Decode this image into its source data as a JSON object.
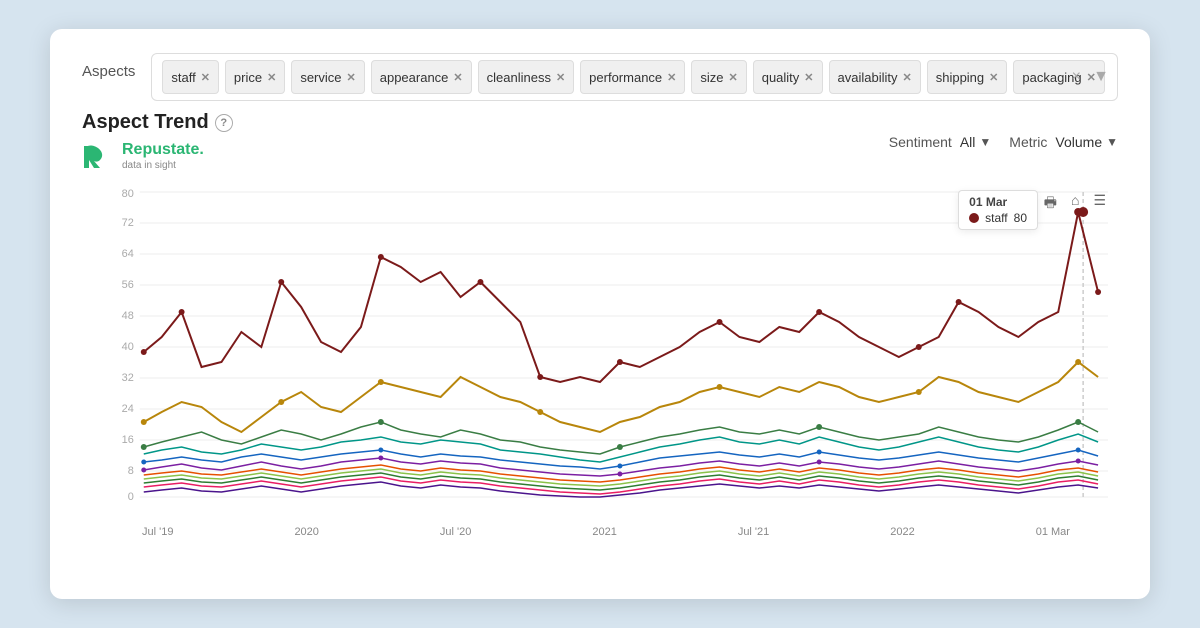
{
  "card": {
    "aspects_label": "Aspects",
    "title": "Aspect Trend",
    "logo_brand": "Repustate",
    "logo_dot": ".",
    "logo_tagline": "data in sight",
    "sentiment_label": "Sentiment",
    "sentiment_value": "All",
    "metric_label": "Metric",
    "metric_value": "Volume",
    "tooltip_date": "01 Mar",
    "tooltip_staff_label": "staff",
    "tooltip_staff_value": "80",
    "tags": [
      {
        "id": "staff",
        "label": "staff"
      },
      {
        "id": "price",
        "label": "price"
      },
      {
        "id": "service",
        "label": "service"
      },
      {
        "id": "appearance",
        "label": "appearance"
      },
      {
        "id": "cleanliness",
        "label": "cleanliness"
      },
      {
        "id": "performance",
        "label": "performance"
      },
      {
        "id": "size",
        "label": "size"
      },
      {
        "id": "quality",
        "label": "quality"
      },
      {
        "id": "availability",
        "label": "availability"
      },
      {
        "id": "shipping",
        "label": "shipping"
      },
      {
        "id": "packaging",
        "label": "packaging"
      }
    ],
    "x_labels": [
      "Jul '19",
      "2020",
      "Jul '20",
      "2021",
      "Jul '21",
      "2022",
      "01 Mar"
    ],
    "y_labels": [
      "0",
      "8",
      "16",
      "24",
      "32",
      "40",
      "48",
      "56",
      "64",
      "72",
      "80"
    ],
    "chart_icons": [
      "print-icon",
      "home-icon",
      "menu-icon"
    ]
  }
}
